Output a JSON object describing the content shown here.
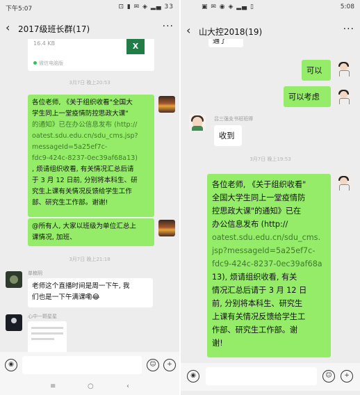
{
  "left": {
    "status": {
      "time": "下午5:07",
      "icons": "⊡ ▮ ✉ ◈ ▂▄ 33"
    },
    "title": "2017级班长群(17)",
    "file": {
      "size": "16.4 KB",
      "icon_label": "X",
      "footer": "微信电脑版"
    },
    "stamp1": "3月7日 晚上20:53",
    "msg1": [
      "各位老师, 《关于组织收看\"全国大",
      "学生同上一堂疫情防控思政大课\"",
      "的通知》已在办公信息发布 (http://",
      "oatest.sdu.edu.cn/sdu_cms.jsp?",
      "messageId=5a25ef7c-",
      "fdc9-424c-8237-0ec39af68a13)",
      ", 烦请组织收看, 有关情况汇总后请",
      "于 3 月 12 日前, 分别将本科生、研",
      "究生上课有关情况反馈给学生工作",
      "部、研究生工作部。谢谢!"
    ],
    "msg2": [
      "@所有人, 大家以班级为单位汇总上",
      "课情况, 加班、"
    ],
    "stamp2": "3月7日 晚上21:18",
    "sender1": "单楠玥",
    "msg3": [
      "老师这个直播时间是周一下午, 我",
      "们也是一下午满课嘞😂"
    ],
    "sender2": "心中一颗星星"
  },
  "right": {
    "status": {
      "time": "5:08",
      "icons": "▣ ✉ ◉ ◈ ▂▄ ▯"
    },
    "title": "山大控2018(19)",
    "partial": "通了",
    "msg_a": "可以",
    "msg_b": "可以考虑",
    "sender": "吕三强支书班班得",
    "msg_c": "收到",
    "stamp": "3月7日 晚上19:53",
    "msg_d": [
      "各位老师, 《关于组织收看\"",
      "全国大学生同上一堂疫情防",
      "控思政大课\"的通知》已在",
      "办公信息发布 (http://",
      "oatest.sdu.edu.cn/sdu_cms.",
      "jsp?messageId=5a25ef7c-",
      "fdc9-424c-8237-0ec39af68a",
      "13), 烦请组织收看, 有关",
      "情况汇总后请于 3 月 12 日",
      "前, 分别将本科生、研究生",
      "上课有关情况反馈给学生工",
      "作部、研究生工作部。谢",
      "谢!"
    ]
  },
  "icons": {
    "voice": "voice-icon",
    "emoji": "emoji-icon",
    "plus": "plus-icon",
    "back": "back-chevron-icon",
    "more": "more-icon"
  },
  "glyphs": {
    "back": "‹",
    "more": "···",
    "voice": "◉",
    "emoji": "☺",
    "plus": "+",
    "nav_menu": "≡",
    "nav_home": "○",
    "nav_back": "‹"
  },
  "colors": {
    "green_bubble": "#95ec69",
    "background": "#ededed",
    "excel": "#1f7d45"
  }
}
